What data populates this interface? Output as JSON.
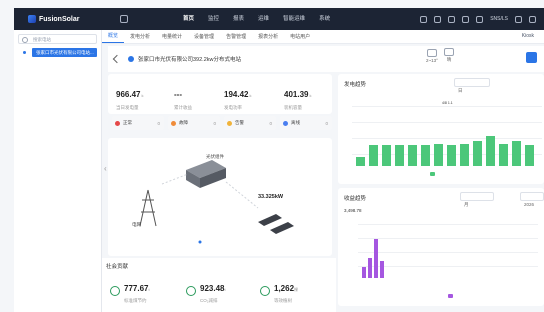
{
  "app": {
    "logo": "FusionSolar"
  },
  "nav": [
    "首页",
    "监控",
    "报表",
    "运维",
    "智能运维",
    "系统"
  ],
  "nav_active": 0,
  "header_right": {
    "user": "SNS/LS"
  },
  "sidebar": {
    "search_placeholder": "搜索电站",
    "selected_item": "张家口市光伏有限公司电站..."
  },
  "tabs": [
    "概览",
    "发电分析",
    "电量统计",
    "设备管理",
    "告警管理",
    "报表分析",
    "电站用户"
  ],
  "tab_active": 0,
  "tabs_right": "Kiosk",
  "site": {
    "name": "张家口市光伏有限公司392.2kw分布式电站"
  },
  "weather": [
    {
      "label": "2~13°"
    },
    {
      "label": "晴"
    }
  ],
  "kpis": [
    {
      "value": "966.47",
      "unit": "k",
      "label": "当日发电量"
    },
    {
      "value": "---",
      "unit": "",
      "label": "累计收益"
    },
    {
      "value": "194.42",
      "unit": "k",
      "label": "发电功率"
    },
    {
      "value": "401.39",
      "unit": "k",
      "label": "装机容量"
    }
  ],
  "status": [
    {
      "label": "正常",
      "count": "0",
      "color": "#e54848"
    },
    {
      "label": "故障",
      "count": "0",
      "color": "#f08c3a"
    },
    {
      "label": "告警",
      "count": "0",
      "color": "#f0b33a"
    },
    {
      "label": "离线",
      "count": "0",
      "color": "#4a7ef0"
    }
  ],
  "diagram": {
    "top_label": "光伏组件",
    "grid_label": "电网",
    "power_value": "33.325kW"
  },
  "bottom": {
    "title": "社会贡献",
    "items": [
      {
        "value": "777.67",
        "unit": "t",
        "label": "标准煤节约"
      },
      {
        "value": "923.48",
        "unit": "t",
        "label": "CO₂减排"
      },
      {
        "value": "1,262",
        "unit": "棵",
        "label": "等效植树"
      }
    ]
  },
  "panel1": {
    "title": "发电趋势",
    "dropdown": "日",
    "highlight_label": "4/8 1.1"
  },
  "panel2": {
    "title": "收益趋势",
    "dropdown": "月",
    "year": "2026",
    "total": "3,498.78"
  },
  "chart_data": [
    {
      "type": "bar",
      "title": "发电趋势",
      "values": [
        6,
        14,
        14,
        14,
        14,
        14,
        15,
        14,
        15,
        17,
        20,
        15,
        17,
        14
      ],
      "series": [
        {
          "name": "发电量",
          "values": [
            6,
            14,
            14,
            14,
            14,
            14,
            15,
            14,
            15,
            17,
            20,
            15,
            17,
            14
          ]
        }
      ],
      "ylim": [
        0,
        40
      ]
    },
    {
      "type": "bar",
      "title": "收益趋势",
      "values": [
        40,
        70,
        140,
        60,
        0,
        0,
        0,
        0,
        0,
        0,
        0,
        0
      ],
      "series": [
        {
          "name": "收益",
          "values": [
            40,
            70,
            140,
            60,
            0,
            0,
            0,
            0,
            0,
            0,
            0,
            0
          ]
        }
      ],
      "ylim": [
        0,
        200
      ]
    }
  ]
}
